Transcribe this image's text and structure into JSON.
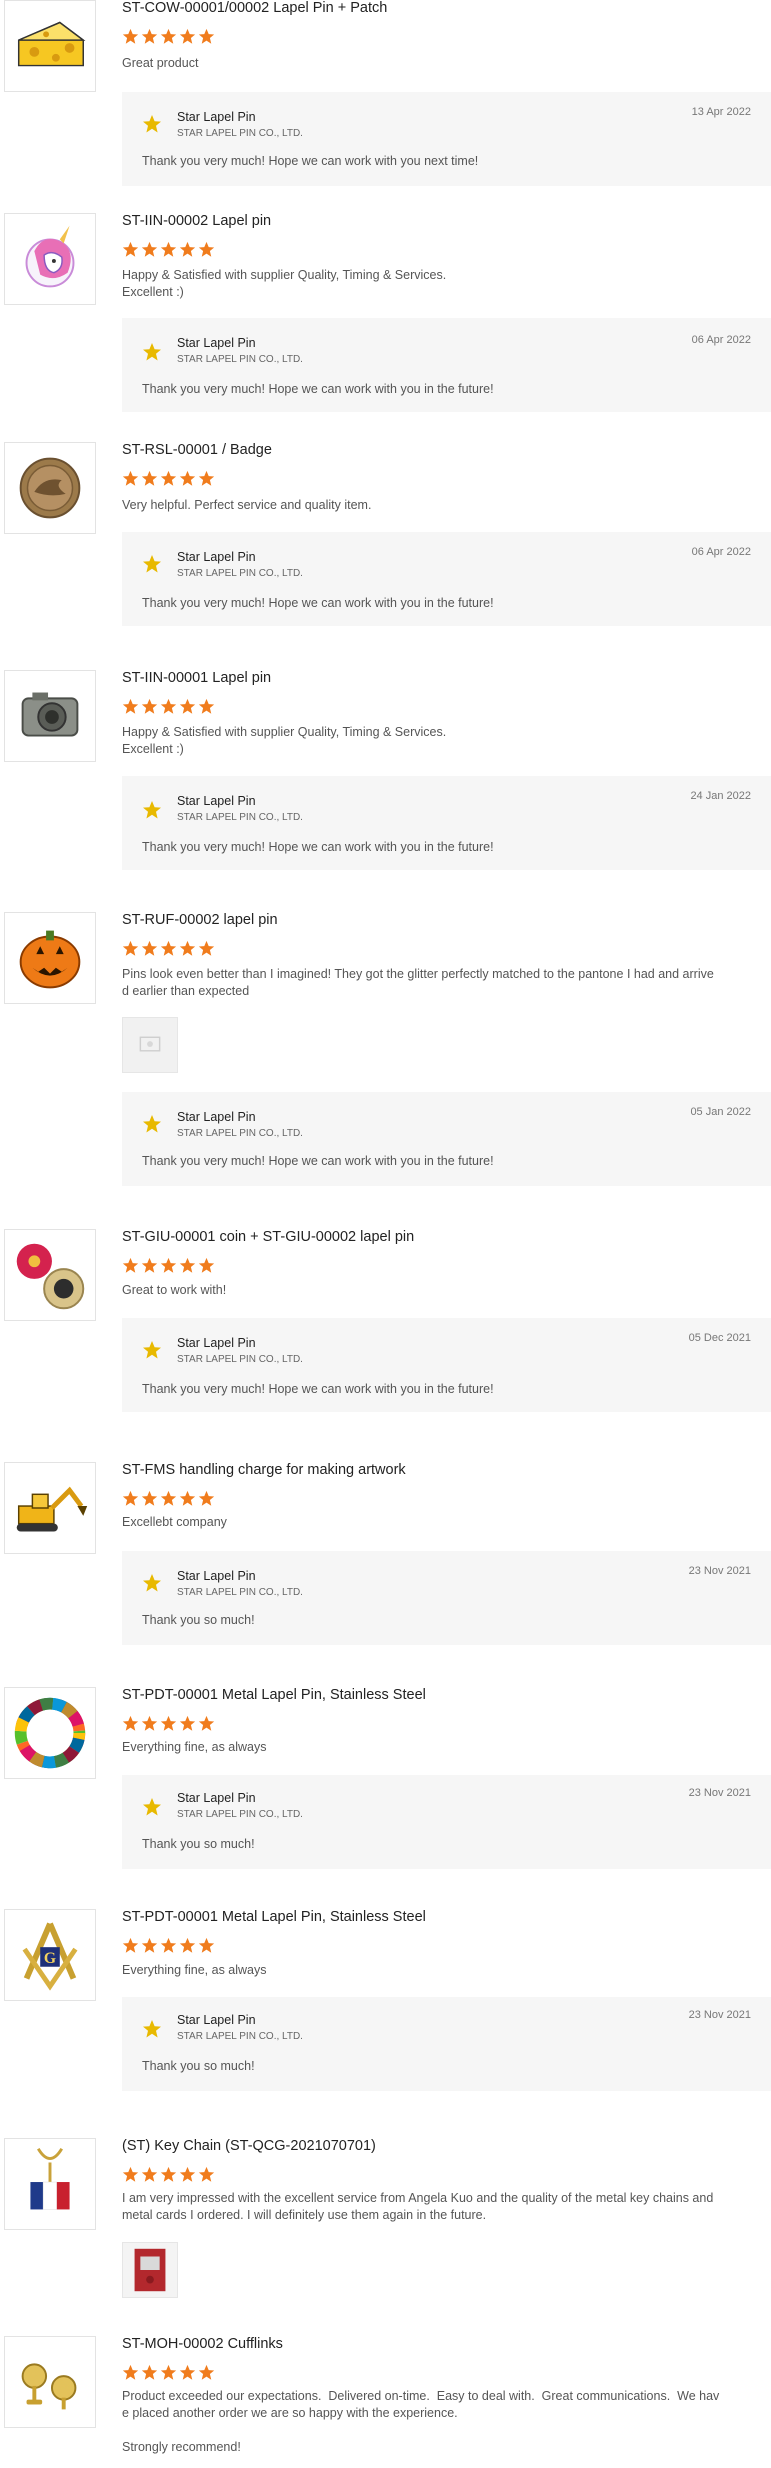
{
  "colors": {
    "star": "#f07c1d",
    "reply_bg": "#f6f6f6",
    "logo_star": "#e8b900"
  },
  "reviews": [
    {
      "product": "ST-COW-00001/00002 Lapel Pin + Patch",
      "rating": 5,
      "text": "Great product",
      "icon": "cheese-pin-icon",
      "reply": {
        "name": "Star Lapel Pin",
        "company": "STAR LAPEL PIN CO., LTD.",
        "date": "13 Apr 2022",
        "text": "Thank you very much! Hope we can work with you next time!"
      }
    },
    {
      "product": "ST-IIN-00002 Lapel pin",
      "rating": 5,
      "text": "Happy & Satisfied with supplier Quality, Timing & Services.\nExcellent :)",
      "icon": "unicorn-pin-icon",
      "reply": {
        "name": "Star Lapel Pin",
        "company": "STAR LAPEL PIN CO., LTD.",
        "date": "06 Apr 2022",
        "text": "Thank you very much! Hope we can work with you in the future!"
      }
    },
    {
      "product": "ST-RSL-00001 / Badge",
      "rating": 5,
      "text": "Very helpful. Perfect service and quality item.",
      "icon": "bronze-badge-icon",
      "reply": {
        "name": "Star Lapel Pin",
        "company": "STAR LAPEL PIN CO., LTD.",
        "date": "06 Apr 2022",
        "text": "Thank you very much! Hope we can work with you in the future!"
      }
    },
    {
      "product": "ST-IIN-00001 Lapel pin",
      "rating": 5,
      "text": "Happy & Satisfied with supplier Quality, Timing & Services.\nExcellent :)",
      "icon": "camera-pin-icon",
      "reply": {
        "name": "Star Lapel Pin",
        "company": "STAR LAPEL PIN CO., LTD.",
        "date": "24 Jan 2022",
        "text": "Thank you very much! Hope we can work with you in the future!"
      }
    },
    {
      "product": "ST-RUF-00002 lapel pin",
      "rating": 5,
      "text": "Pins look even better than I imagined! They got the glitter perfectly matched to the pantone I had and arrive\nd earlier than expected",
      "icon": "pumpkin-pin-icon",
      "attachment": "review-photo-icon",
      "reply": {
        "name": "Star Lapel Pin",
        "company": "STAR LAPEL PIN CO., LTD.",
        "date": "05 Jan 2022",
        "text": "Thank you very much! Hope we can work with you in the future!"
      }
    },
    {
      "product": "ST-GIU-00001 coin + ST-GIU-00002 lapel pin",
      "rating": 5,
      "text": "Great to work with!",
      "icon": "flower-coin-pin-icon",
      "reply": {
        "name": "Star Lapel Pin",
        "company": "STAR LAPEL PIN CO., LTD.",
        "date": "05 Dec 2021",
        "text": "Thank you very much! Hope we can work with you in the future!"
      }
    },
    {
      "product": "ST-FMS handling charge for making artwork",
      "rating": 5,
      "text": "Excellebt company",
      "icon": "excavator-pin-icon",
      "reply": {
        "name": "Star Lapel Pin",
        "company": "STAR LAPEL PIN CO., LTD.",
        "date": "23 Nov 2021",
        "text": "Thank you so much!"
      }
    },
    {
      "product": "ST-PDT-00001 Metal Lapel Pin, Stainless Steel",
      "rating": 5,
      "text": "Everything fine, as always",
      "icon": "sdg-wheel-pin-icon",
      "reply": {
        "name": "Star Lapel Pin",
        "company": "STAR LAPEL PIN CO., LTD.",
        "date": "23 Nov 2021",
        "text": "Thank you so much!"
      }
    },
    {
      "product": "ST-PDT-00001 Metal Lapel Pin, Stainless Steel",
      "rating": 5,
      "text": "Everything fine, as always",
      "icon": "masonic-pin-icon",
      "reply": {
        "name": "Star Lapel Pin",
        "company": "STAR LAPEL PIN CO., LTD.",
        "date": "23 Nov 2021",
        "text": "Thank you so much!"
      }
    },
    {
      "product": "(ST) Key Chain (ST-QCG-2021070701)",
      "rating": 5,
      "text": "I am very impressed with the excellent service from Angela Kuo and the quality of the metal key chains and\nmetal cards I ordered. I will definitely use them again in the future.",
      "icon": "flag-keychain-icon",
      "attachment": "key-chain-photo-icon"
    },
    {
      "product": "ST-MOH-00002 Cufflinks",
      "rating": 5,
      "text": "Product exceeded our expectations.  Delivered on-time.  Easy to deal with.  Great communications.  We hav\ne placed another order we are so happy with the experience.\n\nStrongly recommend!",
      "icon": "cufflinks-icon"
    }
  ]
}
